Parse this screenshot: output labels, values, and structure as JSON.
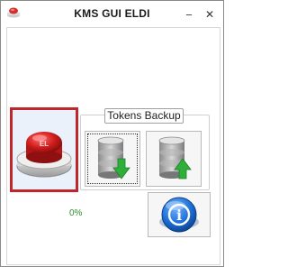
{
  "window": {
    "title": "KMS GUI ELDI",
    "minimize_glyph": "─",
    "close_glyph": "✕"
  },
  "activate_button": {
    "icon": "red-push-button-icon",
    "label": "EL"
  },
  "tokens_group": {
    "label": "Tokens Backup",
    "backup_icon": "database-down-arrow-icon",
    "restore_icon": "database-up-arrow-icon"
  },
  "status": {
    "progress": "0%"
  },
  "info_button": {
    "icon": "info-icon",
    "glyph": "i"
  },
  "colors": {
    "activate_border": "#c0262b",
    "progress_text": "#2d8f2d",
    "arrow_green": "#2fae3a",
    "info_blue": "#1c6fd6"
  }
}
